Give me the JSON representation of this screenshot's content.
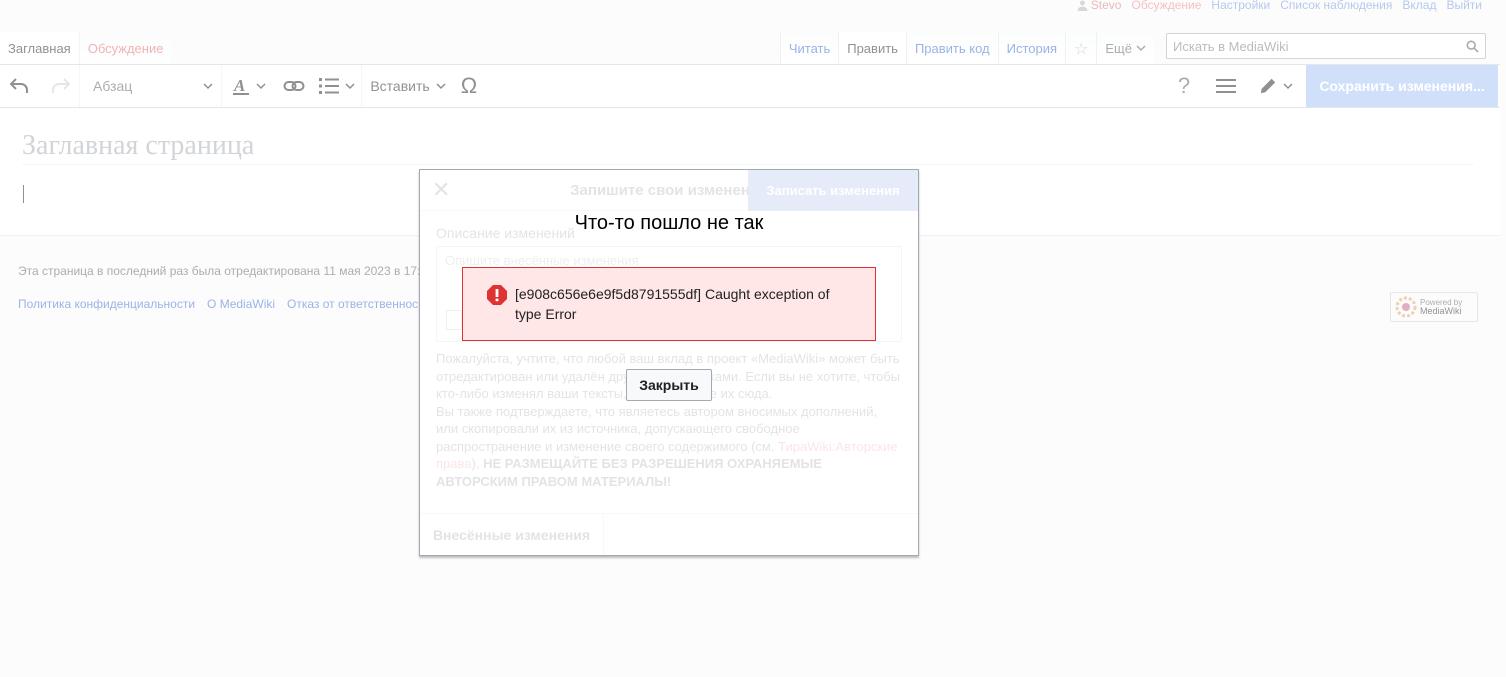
{
  "personal": {
    "username": "Stevo",
    "talk": "Обсуждение",
    "preferences": "Настройки",
    "watchlist": "Список наблюдения",
    "contributions": "Вклад",
    "logout": "Выйти"
  },
  "tabs": {
    "main": "Заглавная",
    "discussion": "Обсуждение",
    "read": "Читать",
    "edit": "Править",
    "edit_source": "Править код",
    "history": "История",
    "more": "Ещё"
  },
  "search": {
    "placeholder": "Искать в MediaWiki"
  },
  "toolbar": {
    "paragraph": "Абзац",
    "insert": "Вставить",
    "save": "Сохранить изменения..."
  },
  "content": {
    "title": "Заглавная страница"
  },
  "footer": {
    "last_modified": "Эта страница в последний раз была отредактирована 11 мая 2023 в 17:",
    "links": [
      "Политика конфиденциальности",
      "О MediaWiki",
      "Отказ от ответственнос"
    ],
    "powered_line1": "Powered by",
    "powered_line2": "MediaWiki"
  },
  "dialog": {
    "title": "Запишите свои изменения",
    "primary": "Записать изменения",
    "summary_label": "Описание изменений",
    "summary_placeholder": "Опишите внесённые изменения",
    "license_p1": "Пожалуйста, учтите, что любой ваш вклад в проект «MediaWiki» может быть отредактирован или удалён другими участниками. Если вы не хотите, чтобы кто-либо изменял ваши тексты, не помещайте их сюда.",
    "license_p2": "Вы также подтверждаете, что являетесь автором вносимых дополнений, или скопировали их из источника, допускающего свободное распространение и изменение своего содержимого (см.",
    "license_link": "ТираWiki:Авторские права",
    "license_warning": "НЕ РАЗМЕЩАЙТЕ БЕЗ РАЗРЕШЕНИЯ ОХРАНЯЕМЫЕ АВТОРСКИМ ПРАВОМ МАТЕРИАЛЫ!",
    "review": "Внесённые изменения"
  },
  "error": {
    "heading": "Что-то пошло не так",
    "message": "[e908c656e6e9f5d8791555df] Caught exception of type Error",
    "close": "Закрыть"
  },
  "colors": {
    "accent": "#3366cc",
    "error_bg": "#fee7e6",
    "error_border": "#dd3333",
    "save_disabled": "#a3c0f4"
  }
}
